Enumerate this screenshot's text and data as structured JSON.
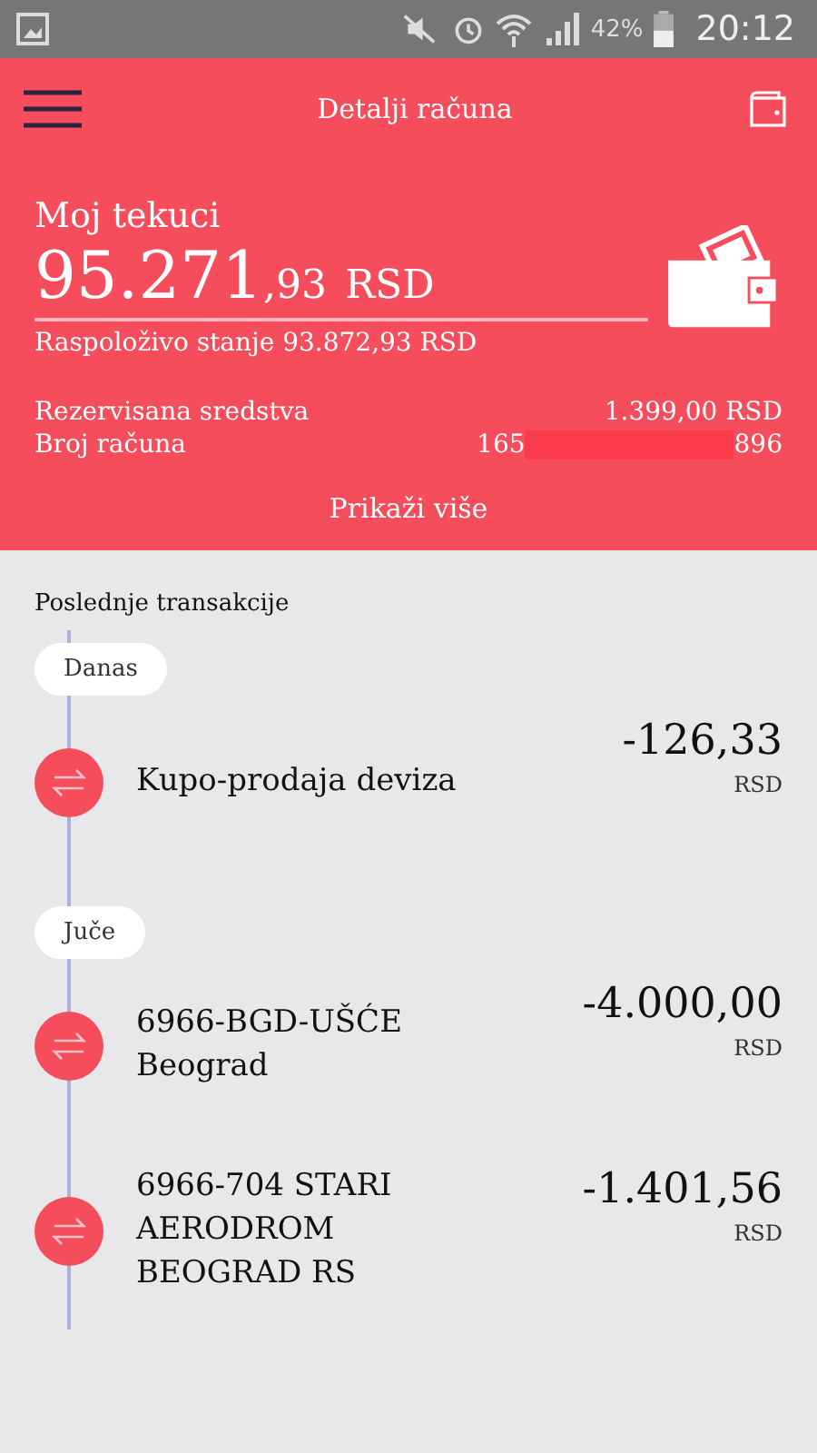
{
  "status_bar": {
    "battery_percent": "42%",
    "time": "20:12"
  },
  "toolbar": {
    "title": "Detalji računa"
  },
  "account": {
    "name": "Moj tekuci",
    "balance_whole": "95.271",
    "balance_decimal": ",93",
    "currency": "RSD",
    "available": "Raspoloživo stanje 93.872,93 RSD",
    "details": [
      {
        "kind": "text",
        "label": "Rezervisana sredstva",
        "value": "1.399,00 RSD"
      },
      {
        "kind": "masked",
        "label": "Broj računa",
        "prefix": "165",
        "suffix": "896"
      }
    ],
    "more_link": "Prikaži više"
  },
  "transactions": {
    "title": "Poslednje transakcije",
    "groups": [
      {
        "label": "Danas",
        "items": [
          {
            "name": "Kupo-prodaja deviza",
            "amount": "-126,33",
            "currency": "RSD"
          }
        ]
      },
      {
        "label": "Juče",
        "items": [
          {
            "name": "6966-BGD-UŠĆE Beograd",
            "amount": "-4.000,00",
            "currency": "RSD"
          },
          {
            "name": "6966-704 STARI AERODROM BEOGRAD RS",
            "amount": "-1.401,56",
            "currency": "RSD"
          }
        ]
      }
    ]
  }
}
